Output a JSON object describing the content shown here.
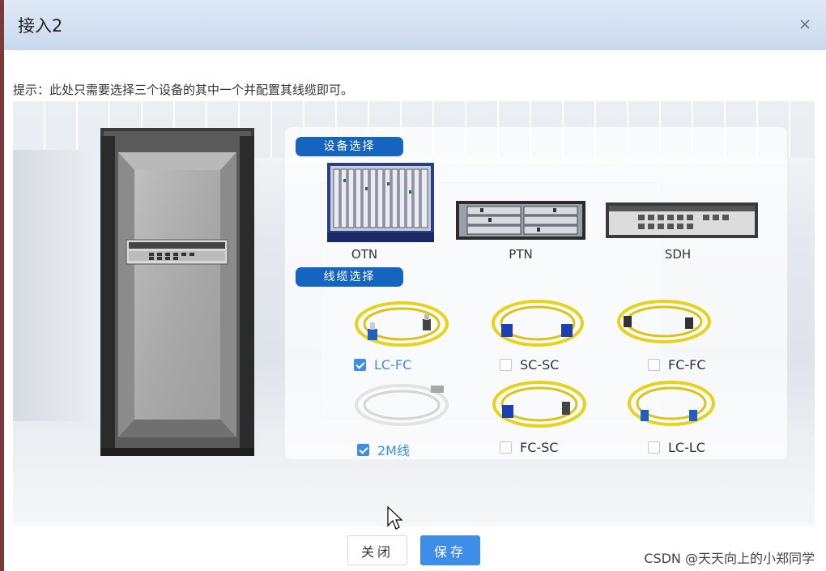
{
  "dialog": {
    "title": "接入2"
  },
  "tip": "提示：此处只需要选择三个设备的其中一个并配置其线缆即可。",
  "device_section": {
    "label": "设备选择",
    "devices": [
      {
        "label": "OTN"
      },
      {
        "label": "PTN"
      },
      {
        "label": "SDH"
      }
    ]
  },
  "cable_section": {
    "label": "线缆选择",
    "cables": [
      {
        "label": "LC-FC",
        "checked": true
      },
      {
        "label": "SC-SC",
        "checked": false
      },
      {
        "label": "FC-FC",
        "checked": false
      },
      {
        "label": "2M线",
        "checked": true
      },
      {
        "label": "FC-SC",
        "checked": false
      },
      {
        "label": "LC-LC",
        "checked": false
      }
    ]
  },
  "buttons": {
    "close_label": "关闭",
    "save_label": "保存"
  },
  "watermark": "CSDN @天天向上的小郑同学",
  "colors": {
    "accent": "#3d8ee8",
    "section_tag": "#1565c0",
    "cable_yellow": "#e8d21a",
    "cable_white": "#e2e4e2"
  }
}
